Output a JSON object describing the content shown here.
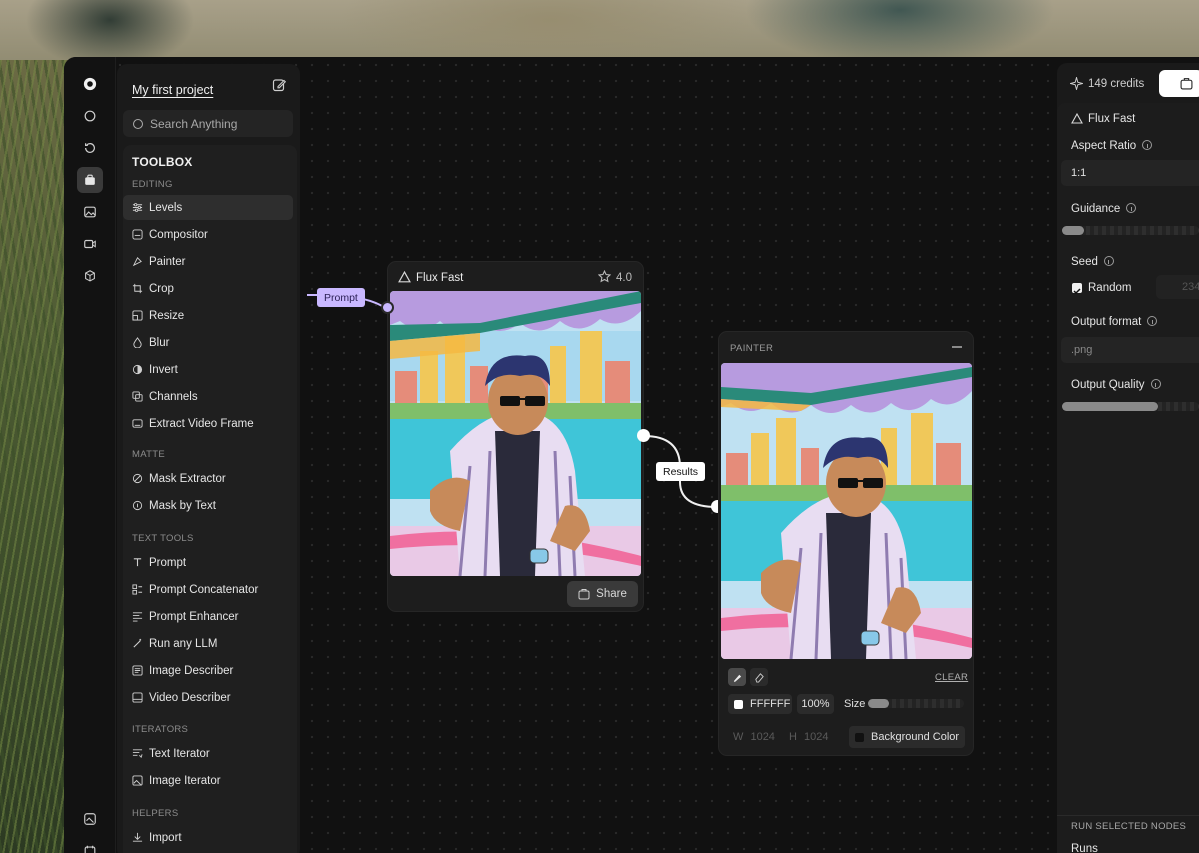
{
  "project": {
    "title": "My first project"
  },
  "search": {
    "placeholder": "Search Anything"
  },
  "toolbox": {
    "title": "TOOLBOX",
    "sections": {
      "editing": "EDITING",
      "matte": "MATTE",
      "text_tools": "TEXT TOOLS",
      "iterators": "ITERATORS",
      "helpers": "HELPERS"
    },
    "editing_items": [
      "Levels",
      "Compositor",
      "Painter",
      "Crop",
      "Resize",
      "Blur",
      "Invert",
      "Channels",
      "Extract Video Frame"
    ],
    "matte_items": [
      "Mask Extractor",
      "Mask by Text"
    ],
    "text_items": [
      "Prompt",
      "Prompt Concatenator",
      "Prompt Enhancer",
      "Run any LLM",
      "Image Describer",
      "Video Describer"
    ],
    "iterator_items": [
      "Text Iterator",
      "Image Iterator"
    ],
    "helper_items": [
      "Import"
    ]
  },
  "flux_node": {
    "title": "Flux Fast",
    "rating": "4.0",
    "share_label": "Share",
    "input_label": "Prompt"
  },
  "connection": {
    "label": "Results"
  },
  "painter_node": {
    "title": "PAINTER",
    "clear_label": "CLEAR",
    "color_hex": "FFFFFF",
    "opacity": "100%",
    "size_label": "Size",
    "width_label": "W",
    "width_value": "1024",
    "height_label": "H",
    "height_value": "1024",
    "bg_color_label": "Background Color",
    "size_slider_fraction": 0.22
  },
  "right_panel": {
    "credits": "149 credits",
    "model": "Flux Fast",
    "aspect_ratio_label": "Aspect Ratio",
    "aspect_ratio_value": "1:1",
    "guidance_label": "Guidance",
    "guidance_fraction": 0.16,
    "seed_label": "Seed",
    "random_label": "Random",
    "seed_value": "234",
    "output_format_label": "Output format",
    "output_format_value": ".png",
    "output_quality_label": "Output Quality",
    "output_quality_fraction": 0.7,
    "run_selected_label": "RUN SELECTED NODES",
    "runs_label": "Runs"
  },
  "colors": {
    "accent_prompt": "#c9b8ff",
    "node_bg": "#1d1d1d",
    "canvas_bg": "#111111"
  }
}
